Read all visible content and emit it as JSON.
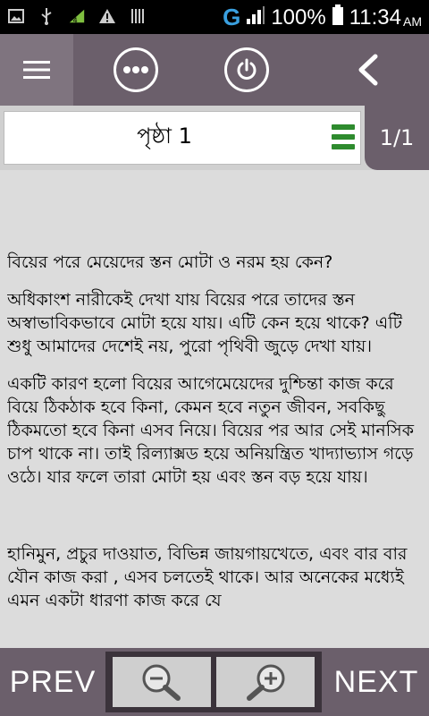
{
  "status_bar": {
    "icons": [
      "image-icon",
      "usb-icon",
      "signal-4-icon",
      "warning-icon",
      "barcode-icon"
    ],
    "network_label": "G",
    "battery_percent": "100%",
    "time": "11:34",
    "ampm": "AM"
  },
  "toolbar": {
    "icons": [
      "menu-icon",
      "more-icon",
      "power-icon",
      "back-icon"
    ]
  },
  "page_header": {
    "title": "পৃষ্ঠা 1",
    "page_count": "1/1"
  },
  "content": {
    "heading": "বিয়ের পরে মেয়েদের স্তন মোটা ও নরম হয় কেন?",
    "paragraphs": [
      "অধিকাংশ নারীকেই দেখা যায় বিয়ের পরে তাদের স্তন অস্বাভাবিকভাবে মোটা হয়ে যায়। এটি কেন হয়ে থাকে? এটি শুধু আমাদের দেশেই নয়, পুরো পৃথিবী জুড়ে দেখা যায়।",
      "একটি কারণ হলো বিয়ের আগেমেয়েদের দুশ্চিন্তা কাজ করে বিয়ে ঠিকঠাক হবে কিনা, কেমন হবে নতুন জীবন, সবকিছু ঠিকমতো হবে কিনা এসব নিয়ে। বিয়ের পর আর সেই মানসিক চাপ থাকে না। তাই রিল্যাক্সড হয়ে অনিয়ন্ত্রিত খাদ্যাভ্যাস গড়ে ওঠে। যার ফলে তারা মোটা হয় এবং স্তন বড় হয়ে যায়।",
      "হানিমুন, প্রচুর দাওয়াত, বিভিন্ন জায়গায়খেতে, এবং বার বার যৌন কাজ করা , এসব চলতেই থাকে। আর অনেকের মধ্যেই এমন একটা ধারণা কাজ করে যে"
    ]
  },
  "bottom_bar": {
    "prev_label": "PREV",
    "next_label": "NEXT",
    "zoom_icons": [
      "zoom-out-icon",
      "zoom-in-icon"
    ]
  },
  "colors": {
    "toolbar_bg": "#6b5f6b",
    "page_bg": "#dcdcdc",
    "accent_green": "#2e8b2e",
    "network_blue": "#3aa0e0"
  }
}
